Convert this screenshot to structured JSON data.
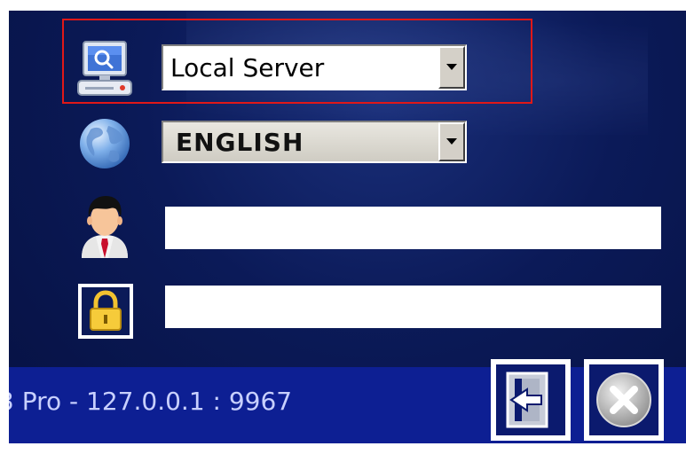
{
  "server": {
    "icon": "server-monitor-icon",
    "selected": "Local Server"
  },
  "language": {
    "icon": "globe-icon",
    "selected": "ENGLISH"
  },
  "username": {
    "icon": "user-avatar-icon",
    "value": ""
  },
  "password": {
    "icon": "padlock-icon",
    "value": ""
  },
  "status": {
    "text": "3 Pro - 127.0.0.1 : 9967"
  },
  "actions": {
    "login_icon": "login-door-icon",
    "exit_icon": "close-circle-icon"
  },
  "colors": {
    "background": "#0b1a58",
    "status_bar": "#0d1f93",
    "highlight": "#e01818"
  }
}
